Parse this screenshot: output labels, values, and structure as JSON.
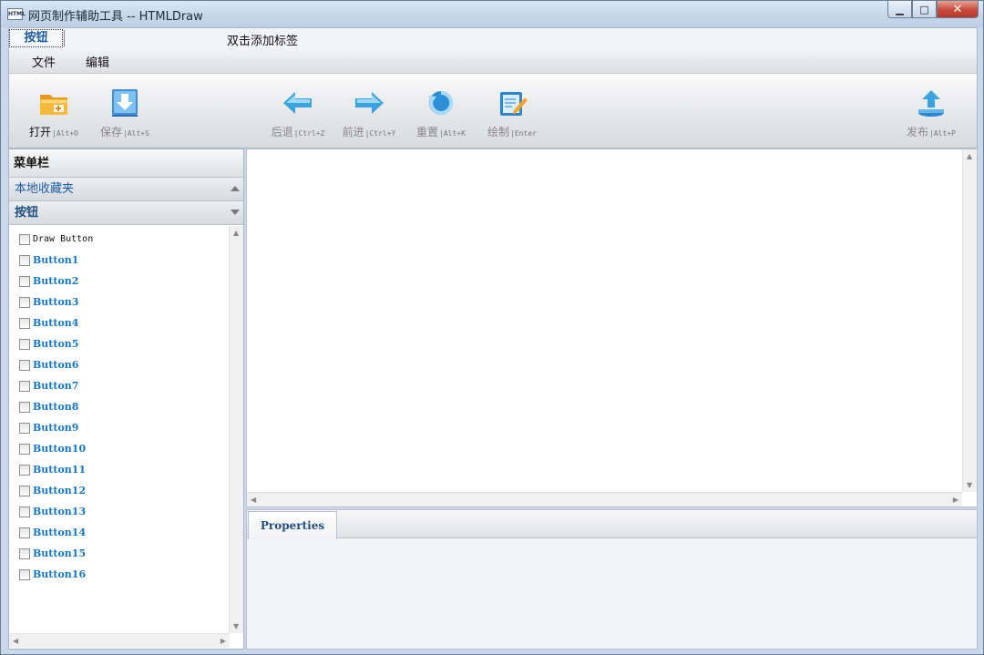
{
  "window": {
    "title": "网页制作辅助工具 -- HTMLDraw",
    "app_icon_text": "HTML",
    "minimize_glyph": "▁",
    "maximize_glyph": "□",
    "close_glyph": "✕"
  },
  "tabs": {
    "active": "按钮",
    "hint": "双击添加标签"
  },
  "menu": {
    "items": [
      "文件",
      "编辑"
    ]
  },
  "toolbar": {
    "open": {
      "label": "打开",
      "shortcut": "|Alt+O",
      "icon": "folder-open-icon"
    },
    "save": {
      "label": "保存",
      "shortcut": "|Alt+S",
      "icon": "save-icon"
    },
    "back": {
      "label": "后退",
      "shortcut": "|Ctrl+Z",
      "icon": "arrow-left-icon"
    },
    "forward": {
      "label": "前进",
      "shortcut": "|Ctrl+Y",
      "icon": "arrow-right-icon"
    },
    "reset": {
      "label": "重置",
      "shortcut": "|Alt+K",
      "icon": "reset-icon"
    },
    "draw": {
      "label": "绘制",
      "shortcut": "|Enter",
      "icon": "draw-icon"
    },
    "publish": {
      "label": "发布",
      "shortcut": "|Alt+P",
      "icon": "upload-icon"
    }
  },
  "left_panel": {
    "header": "菜单栏",
    "section_favorites": "本地收藏夹",
    "section_buttons": "按钮",
    "items": [
      "Draw Button",
      "Button1",
      "Button2",
      "Button3",
      "Button4",
      "Button5",
      "Button6",
      "Button7",
      "Button8",
      "Button9",
      "Button10",
      "Button11",
      "Button12",
      "Button13",
      "Button14",
      "Button15",
      "Button16"
    ]
  },
  "properties": {
    "tab": "Properties"
  },
  "colors": {
    "accent": "#1e5b9e",
    "link": "#1477c5",
    "close": "#c9493a"
  }
}
